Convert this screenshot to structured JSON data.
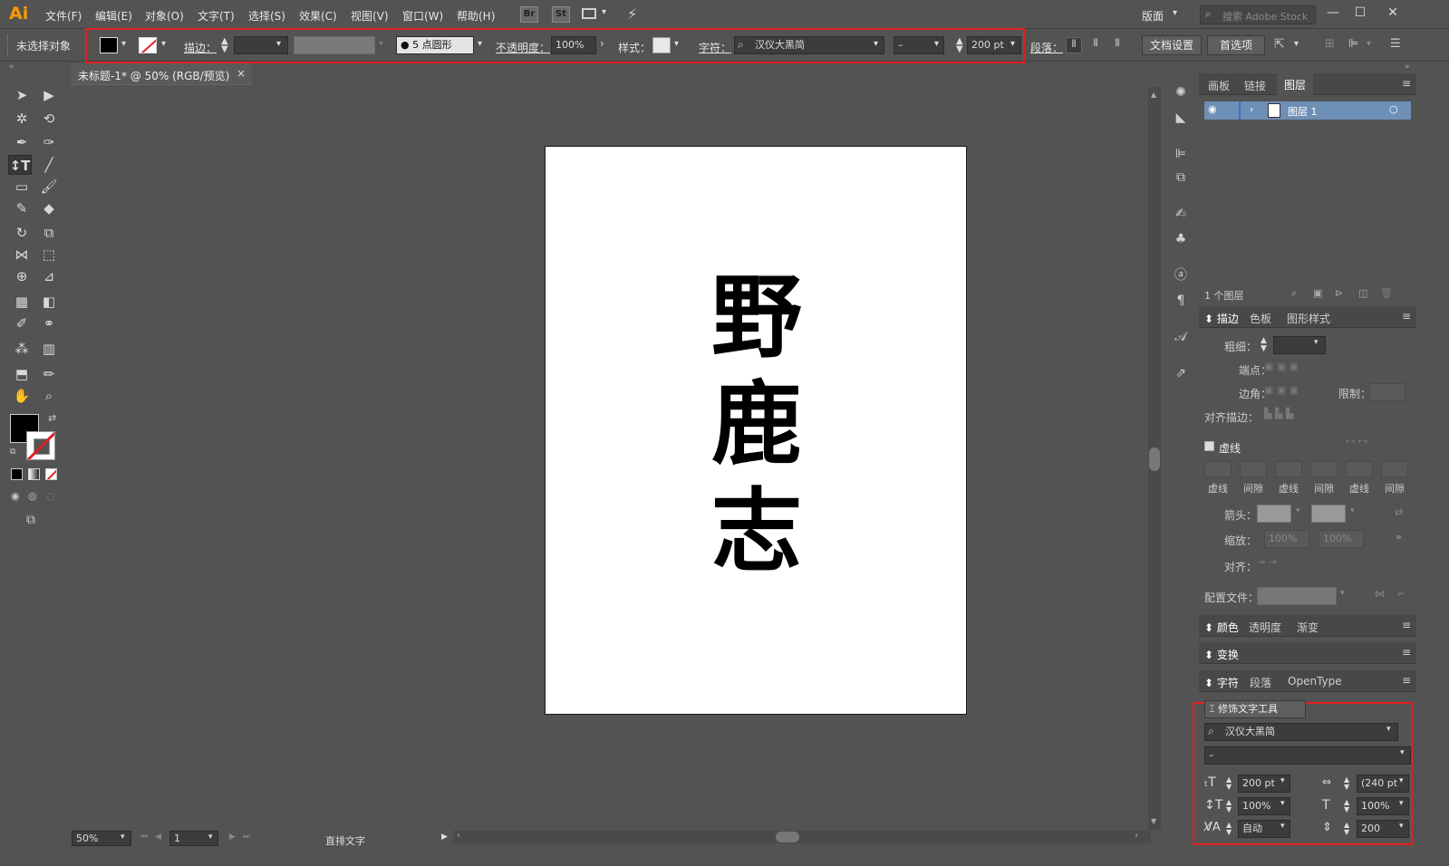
{
  "app": {
    "logo": "Ai"
  },
  "menu": [
    "文件(F)",
    "编辑(E)",
    "对象(O)",
    "文字(T)",
    "选择(S)",
    "效果(C)",
    "视图(V)",
    "窗口(W)",
    "帮助(H)"
  ],
  "menubar_icons": {
    "bridge": "Br",
    "stock": "St"
  },
  "workspace": {
    "label": "版面",
    "search_placeholder": "搜索 Adobe Stock"
  },
  "window_buttons": {
    "minimize": "—",
    "maximize": "☐",
    "close": "✕"
  },
  "control": {
    "no_selection": "未选择对象",
    "stroke_label": "描边：",
    "brush": "● 5 点圆形",
    "opacity_label": "不透明度：",
    "opacity_value": "100%",
    "style_label": "样式：",
    "char_label": "字符：",
    "font_family": "汉仪大黑简",
    "font_style": "–",
    "font_size": "200 pt",
    "para_label": "段落：",
    "doc_setup": "文档设置",
    "preferences": "首选项"
  },
  "document": {
    "tab_title": "未标题-1* @ 50% (RGB/预览)",
    "close": "×"
  },
  "artboard": {
    "glyphs": [
      "野",
      "鹿",
      "志"
    ]
  },
  "status": {
    "zoom": "50%",
    "artboard_num": "1",
    "tool": "直排文字"
  },
  "layers_panel": {
    "tabs": [
      "画板",
      "链接",
      "图层"
    ],
    "active_tab": "图层",
    "layer_name": "图层 1",
    "footer": "1 个图层"
  },
  "stroke_panel": {
    "tabs": [
      "描边",
      "色板",
      "图形样式"
    ],
    "weight_label": "粗细：",
    "cap_label": "端点：",
    "corner_label": "边角：",
    "limit_label": "限制：",
    "align_label": "对齐描边：",
    "dashed_label": "虚线",
    "dash_cols": [
      "虚线",
      "间隙",
      "虚线",
      "间隙",
      "虚线",
      "间隙"
    ],
    "arrow_label": "箭头：",
    "scale_label": "缩放：",
    "scale_a": "100%",
    "scale_b": "100%",
    "align2_label": "对齐：",
    "profile_label": "配置文件："
  },
  "color_panel": {
    "tabs": [
      "颜色",
      "透明度",
      "渐变"
    ]
  },
  "transform_panel": {
    "tabs": [
      "变换"
    ]
  },
  "character_panel": {
    "tabs": [
      "字符",
      "段落",
      "OpenType"
    ],
    "touch_tool": "修饰文字工具",
    "font_family": "汉仪大黑简",
    "font_style": "–",
    "font_size": "200 pt",
    "leading": "(240 pt",
    "vscale": "100%",
    "hscale": "100%",
    "kerning": "自动",
    "tracking": "200"
  },
  "colors": {
    "highlight": "#e02020",
    "layer_row": "#6e8fb6",
    "artboard": "#ffffff"
  }
}
